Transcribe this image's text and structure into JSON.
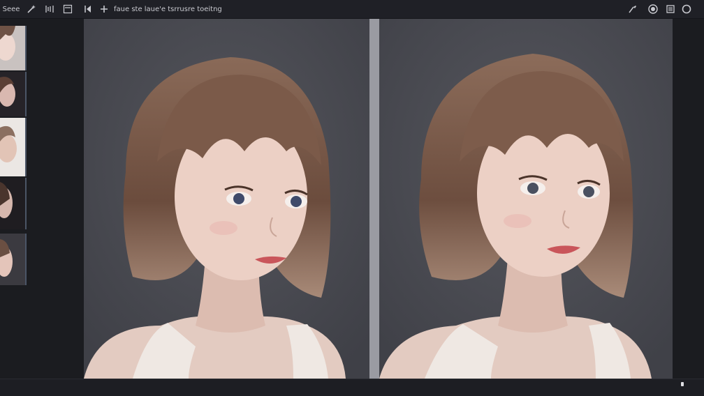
{
  "toolbar": {
    "app_label": "Seee",
    "breadcrumb": "faue ste laue'e tsrrusre toeitng",
    "left_icons": [
      "magic-wand-icon",
      "code-icon",
      "panel-icon",
      "skip-back-icon",
      "add-icon"
    ],
    "right_icons": [
      "brush-icon",
      "target-icon",
      "menu-icon",
      "circle-icon"
    ]
  },
  "thumbnails": [
    {
      "name": "thumbnail-1",
      "selected": false
    },
    {
      "name": "thumbnail-2",
      "selected": false
    },
    {
      "name": "thumbnail-3",
      "selected": false
    },
    {
      "name": "thumbnail-4",
      "selected": false
    },
    {
      "name": "thumbnail-5",
      "selected": false
    }
  ],
  "canvases": [
    {
      "name": "original-image",
      "subject": "portrait of girl with brown bob haircut"
    },
    {
      "name": "edited-image",
      "subject": "portrait of girl with brown bob haircut"
    }
  ],
  "colors": {
    "background": "#1c1d22",
    "canvas_bg": "#4b4c53",
    "divider": "#9a9ba2",
    "hair": "#7a5a48",
    "skin": "#e8c8bc"
  }
}
